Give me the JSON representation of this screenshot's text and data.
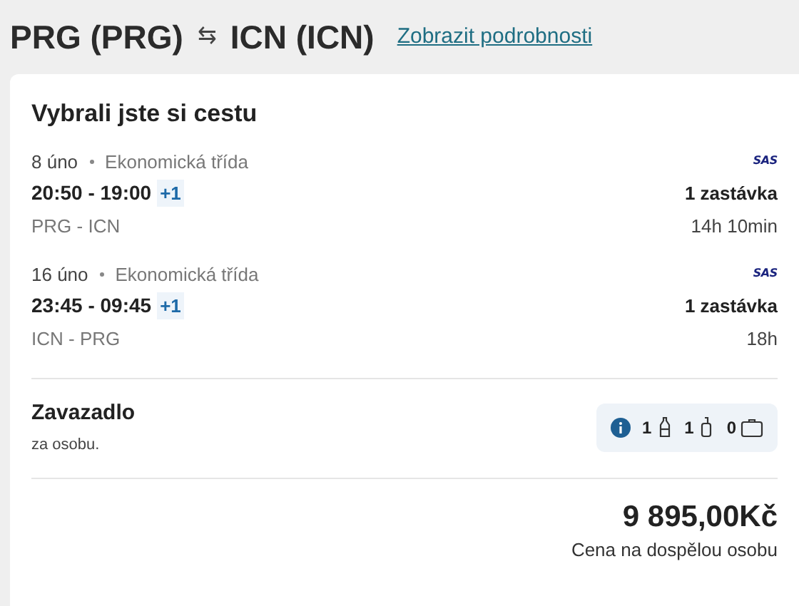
{
  "header": {
    "from": "PRG (PRG)",
    "swap_icon": "⇆",
    "to": "ICN (ICN)",
    "link": "Zobrazit podrobnosti"
  },
  "card": {
    "title": "Vybrali jste si cestu",
    "legs": [
      {
        "date": "8 úno",
        "class": "Ekonomická třída",
        "airline": "SAS",
        "times": "20:50 - 19:00",
        "day_offset": "+1",
        "stops": "1 zastávka",
        "route": "PRG - ICN",
        "duration": "14h 10min"
      },
      {
        "date": "16 úno",
        "class": "Ekonomická třída",
        "airline": "SAS",
        "times": "23:45 - 09:45",
        "day_offset": "+1",
        "stops": "1 zastávka",
        "route": "ICN - PRG",
        "duration": "18h"
      }
    ],
    "baggage": {
      "title": "Zavazadlo",
      "subtitle": "za osobu.",
      "items": [
        {
          "kind": "personal",
          "count": "1"
        },
        {
          "kind": "cabin",
          "count": "1"
        },
        {
          "kind": "checked",
          "count": "0"
        }
      ]
    },
    "price": "9 895,00Kč",
    "price_note": "Cena na dospělou osobu"
  }
}
